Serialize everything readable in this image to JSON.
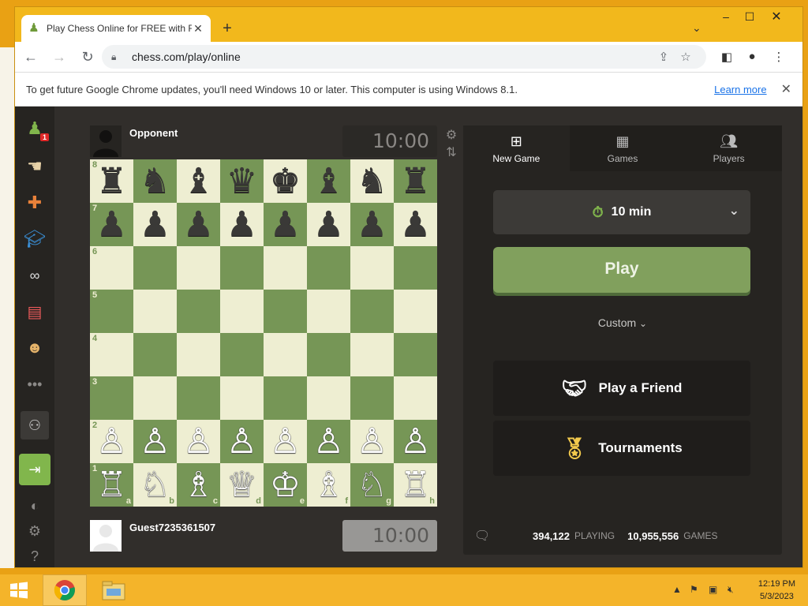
{
  "browser": {
    "tab_title": "Play Chess Online for FREE with F",
    "url": "chess.com/play/online",
    "infobar_message": "To get future Google Chrome updates, you'll need Windows 10 or later. This computer is using Windows 8.1.",
    "infobar_link": "Learn more"
  },
  "leftnav": {
    "notification_count": "1"
  },
  "opponent": {
    "name": "Opponent",
    "clock": "10:00"
  },
  "player": {
    "name": "Guest7235361507",
    "clock": "10:00"
  },
  "board": {
    "ranks": [
      "8",
      "7",
      "6",
      "5",
      "4",
      "3",
      "2",
      "1"
    ],
    "files": [
      "a",
      "b",
      "c",
      "d",
      "e",
      "f",
      "g",
      "h"
    ],
    "rows": [
      [
        "♜",
        "♞",
        "♝",
        "♛",
        "♚",
        "♝",
        "♞",
        "♜"
      ],
      [
        "♟",
        "♟",
        "♟",
        "♟",
        "♟",
        "♟",
        "♟",
        "♟"
      ],
      [
        "",
        "",
        "",
        "",
        "",
        "",
        "",
        ""
      ],
      [
        "",
        "",
        "",
        "",
        "",
        "",
        "",
        ""
      ],
      [
        "",
        "",
        "",
        "",
        "",
        "",
        "",
        ""
      ],
      [
        "",
        "",
        "",
        "",
        "",
        "",
        "",
        ""
      ],
      [
        "♙",
        "♙",
        "♙",
        "♙",
        "♙",
        "♙",
        "♙",
        "♙"
      ],
      [
        "♖",
        "♘",
        "♗",
        "♕",
        "♔",
        "♗",
        "♘",
        "♖"
      ]
    ]
  },
  "panel": {
    "tabs": [
      {
        "label": "New Game",
        "icon": "plus-square-icon"
      },
      {
        "label": "Games",
        "icon": "checkered-board-icon"
      },
      {
        "label": "Players",
        "icon": "players-icon"
      }
    ],
    "time_control": "10 min",
    "play_label": "Play",
    "custom_label": "Custom",
    "play_friend_label": "Play a Friend",
    "tournaments_label": "Tournaments",
    "stats": {
      "playing_count": "394,122",
      "playing_label": "PLAYING",
      "games_count": "10,955,556",
      "games_label": "GAMES"
    }
  },
  "taskbar": {
    "time": "12:19 PM",
    "date": "5/3/2023"
  },
  "colors": {
    "board_light": "#eeeed2",
    "board_dark": "#769656",
    "play_button": "#81a05d",
    "page_bg": "#312e2b"
  }
}
